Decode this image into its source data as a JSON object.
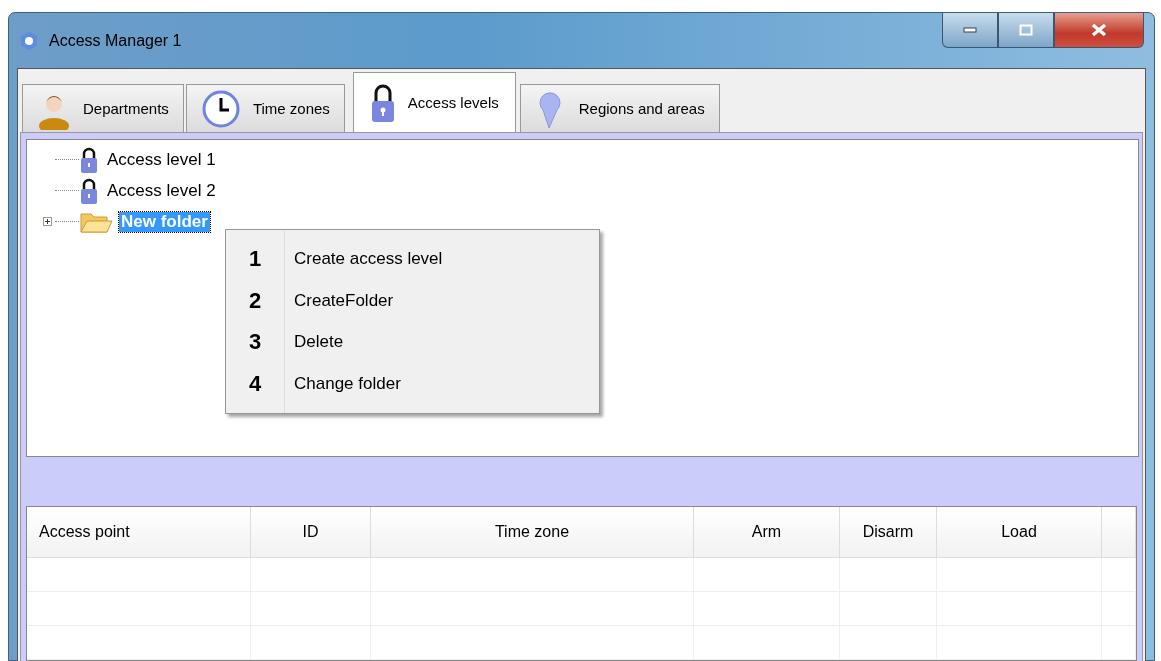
{
  "window": {
    "title": "Access Manager 1"
  },
  "tabs": [
    {
      "label": "Departments",
      "kind": "person",
      "selected": false
    },
    {
      "label": "Time zones",
      "kind": "clock",
      "selected": false
    },
    {
      "label": "Access levels",
      "kind": "lock",
      "selected": true
    },
    {
      "label": "Regions and areas",
      "kind": "pin",
      "selected": false
    }
  ],
  "tree": [
    {
      "label": "Access level 1",
      "kind": "level",
      "selected": false
    },
    {
      "label": "Access level 2",
      "kind": "level",
      "selected": false
    },
    {
      "label": "New folder",
      "kind": "folder",
      "selected": true,
      "expanded": false
    }
  ],
  "context_menu": [
    {
      "number": "1",
      "label": "Create access level"
    },
    {
      "number": "2",
      "label": "CreateFolder"
    },
    {
      "number": "3",
      "label": "Delete"
    },
    {
      "number": "4",
      "label": "Change folder"
    }
  ],
  "table": {
    "columns": [
      "Access point",
      "ID",
      "Time zone",
      "Arm",
      "Disarm",
      "Load"
    ]
  }
}
